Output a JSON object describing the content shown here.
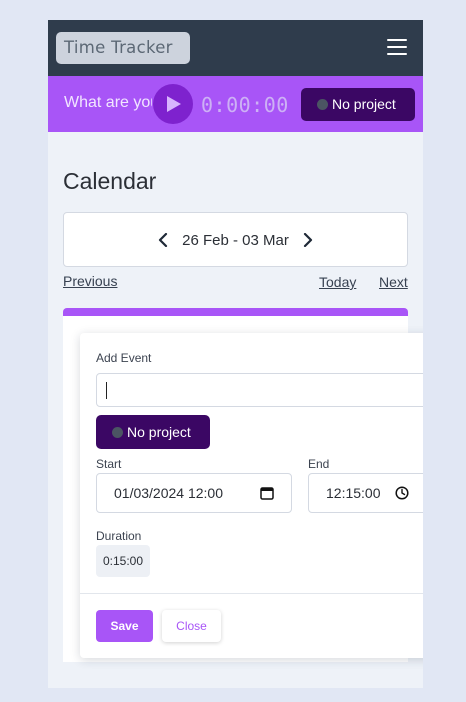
{
  "navbar": {
    "brand": "Time Tracker",
    "menu_icon": "hamburger-menu-icon"
  },
  "timer": {
    "task_placeholder": "What are you working on?",
    "play_icon": "play-icon",
    "elapsed": "0:00:00",
    "project_label": "No project"
  },
  "calendar": {
    "title": "Calendar",
    "week_range": "26 Feb - 03 Mar",
    "previous_label": "Previous",
    "today_label": "Today",
    "next_label": "Next"
  },
  "event_form": {
    "add_event_label": "Add Event",
    "event_value": "",
    "project_label": "No project",
    "start_label": "Start",
    "start_value": "01/03/2024 12:00",
    "end_label": "End",
    "end_value": "12:15:00",
    "duration_label": "Duration",
    "duration_value": "0:15:00",
    "save_label": "Save",
    "close_label": "Close"
  },
  "colors": {
    "accent": "#a855f7",
    "accent_dark": "#3b0764",
    "navbar": "#2f3c4c",
    "play_button": "#7e22ce"
  }
}
